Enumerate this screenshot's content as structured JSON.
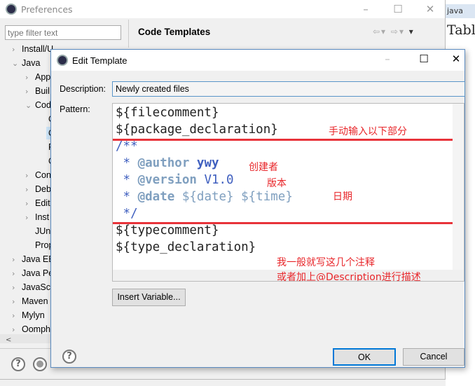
{
  "background_editor": {
    "tab": "java",
    "text": "Tabl"
  },
  "preferences": {
    "title": "Preferences",
    "filter_placeholder": "type filter text",
    "tree": [
      "Install/U",
      "Java",
      "App",
      "Buil",
      "Cod",
      "C",
      "C",
      "F",
      "C",
      "Con",
      "Deb",
      "Edit",
      "Inst",
      "JUn",
      "Prop",
      "Java EE",
      "Java Pe",
      "JavaScr",
      "Maven",
      "Mylyn",
      "Oomph"
    ],
    "panel_title": "Code Templates"
  },
  "dialog": {
    "title": "Edit Template",
    "description_label": "Description:",
    "description_value": "Newly created files",
    "pattern_label": "Pattern:",
    "lines": [
      "${filecomment}",
      "${package_declaration}",
      "/**",
      " * ",
      "@author",
      " ywy",
      " * ",
      "@version",
      " V1.0",
      " * ",
      "@date",
      " ${date} ${time}",
      " */",
      "${typecomment}",
      "${type_declaration}"
    ],
    "insert_variable": "Insert Variable...",
    "ok": "OK",
    "cancel": "Cancel"
  },
  "annotations": {
    "manual_input": "手动输入以下部分",
    "creator": "创建者",
    "version": "版本",
    "date": "日期",
    "note1": "我一般就写这几个注释",
    "note2": "或者加上@Description进行描述"
  },
  "colors": {
    "highlight_box": "#e8333a",
    "annotation": "#e8262a",
    "javadoc": "#3f5fbf"
  }
}
